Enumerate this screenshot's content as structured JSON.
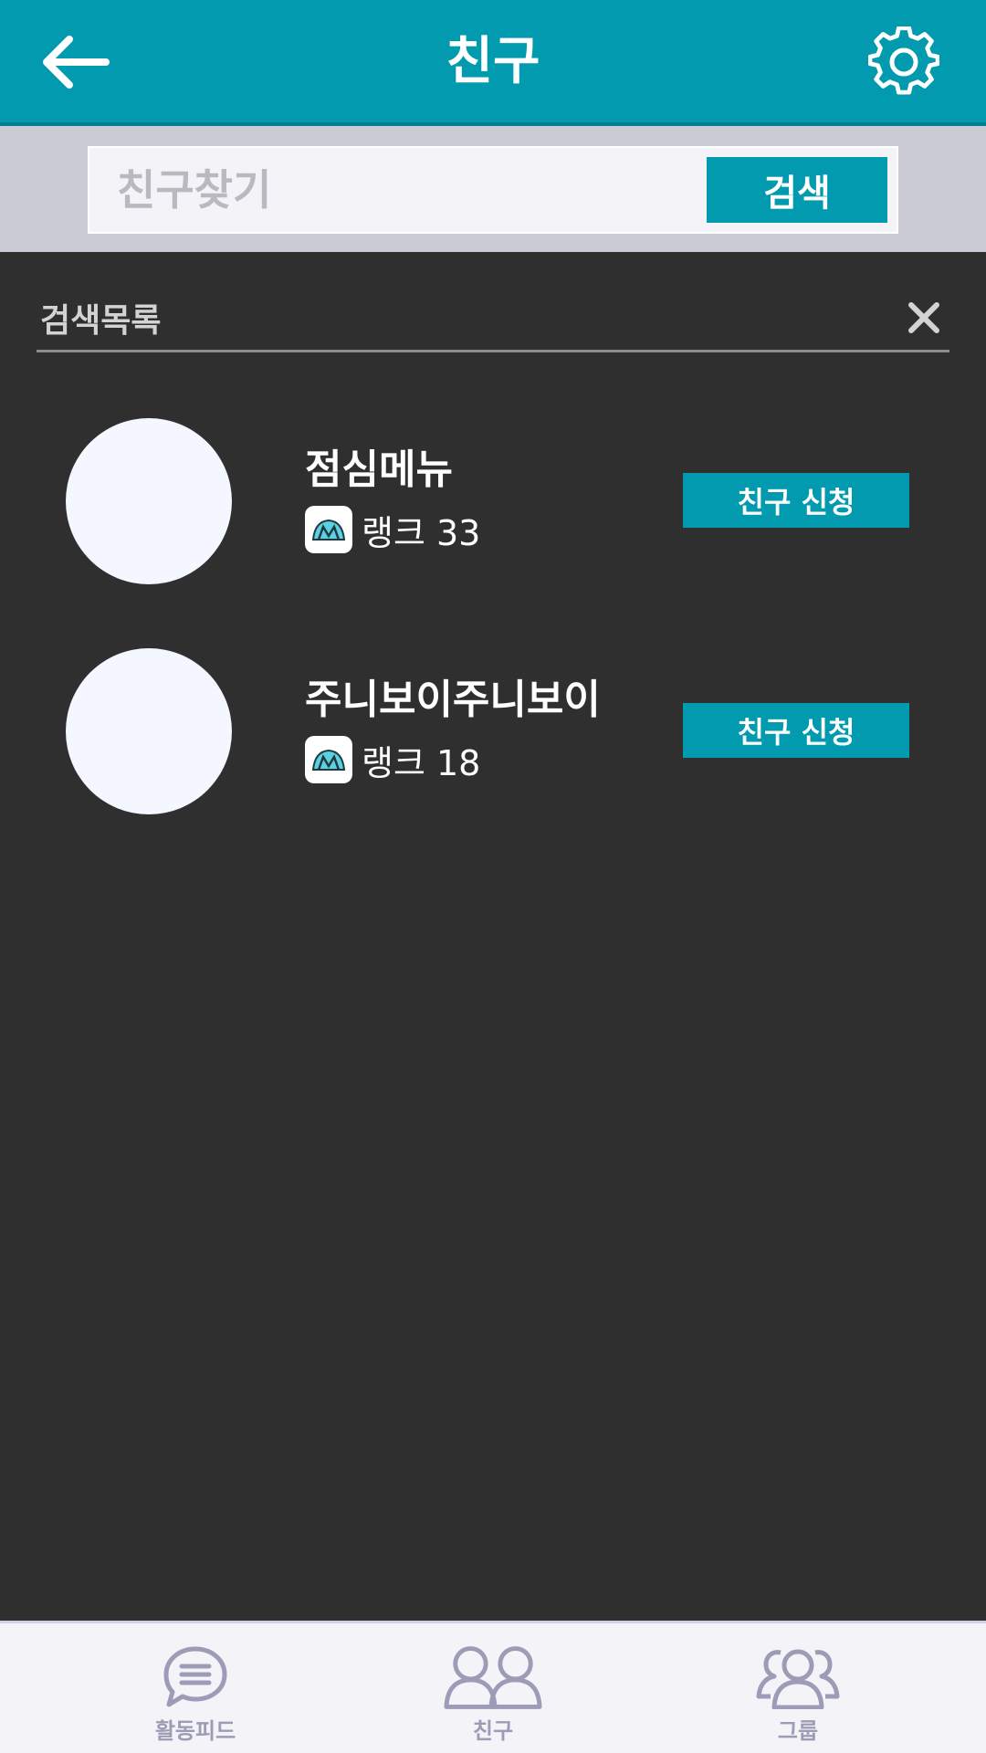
{
  "app_bar": {
    "title": "친구"
  },
  "search": {
    "placeholder": "친구찾기",
    "value": "",
    "button_label": "검색"
  },
  "results": {
    "header_label": "검색목록",
    "items": [
      {
        "name": "점심메뉴",
        "rank_label": "랭크 33",
        "action_label": "친구 신청"
      },
      {
        "name": "주니보이주니보이",
        "rank_label": "랭크 18",
        "action_label": "친구 신청"
      }
    ]
  },
  "bottom_nav": {
    "items": [
      {
        "label": "활동피드",
        "icon": "chat-bubble-icon"
      },
      {
        "label": "친구",
        "icon": "two-people-icon"
      },
      {
        "label": "그룹",
        "icon": "group-icon"
      }
    ]
  },
  "colors": {
    "primary": "#019aae",
    "background": "#2f2f2f",
    "nav_inactive": "#9c9cb6"
  }
}
